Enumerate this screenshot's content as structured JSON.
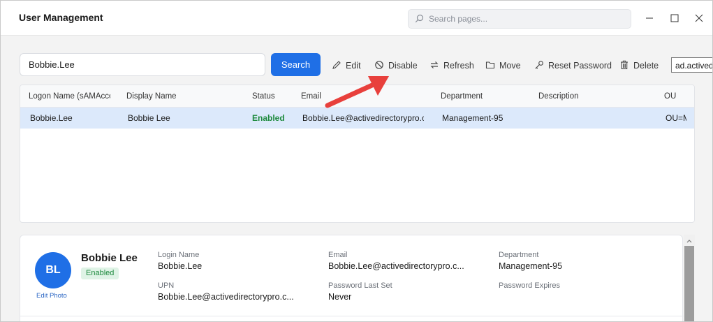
{
  "app": {
    "title": "User Management"
  },
  "page_search": {
    "placeholder": "Search pages..."
  },
  "toolbar": {
    "user_input_value": "Bobbie.Lee",
    "search_label": "Search",
    "edit_label": "Edit",
    "disable_label": "Disable",
    "refresh_label": "Refresh",
    "move_label": "Move",
    "reset_password_label": "Reset Password",
    "delete_label": "Delete",
    "domain_value": "ad.activedirectorypro.com"
  },
  "table": {
    "columns": [
      "Logon Name (sAMAccountName)",
      "Display Name",
      "Status",
      "Email",
      "Department",
      "Description",
      "OU"
    ],
    "rows": [
      {
        "logon": "Bobbie.Lee",
        "display": "Bobbie Lee",
        "status": "Enabled",
        "email": "Bobbie.Lee@activedirectorypro.com",
        "department": "Management-95",
        "description": "",
        "ou": "OU=Management"
      }
    ]
  },
  "details": {
    "initials": "BL",
    "edit_photo": "Edit Photo",
    "name": "Bobbie Lee",
    "status": "Enabled",
    "login_name_label": "Login Name",
    "login_name": "Bobbie.Lee",
    "email_label": "Email",
    "email": "Bobbie.Lee@activedirectorypro.c...",
    "department_label": "Department",
    "department": "Management-95",
    "upn_label": "UPN",
    "upn": "Bobbie.Lee@activedirectorypro.c...",
    "password_last_set_label": "Password Last Set",
    "password_last_set": "Never",
    "password_expires_label": "Password Expires"
  },
  "colors": {
    "accent": "#1f6fe6",
    "selected_row": "#dce9fb",
    "enabled_text": "#1e8a3e",
    "annotation_arrow": "#e8403c"
  },
  "icons": [
    "search-icon",
    "minimize-icon",
    "maximize-icon",
    "close-icon",
    "pencil-icon",
    "ban-icon",
    "refresh-icon",
    "folder-icon",
    "key-icon",
    "trash-icon",
    "chevron-up-icon",
    "red-arrow-icon"
  ]
}
